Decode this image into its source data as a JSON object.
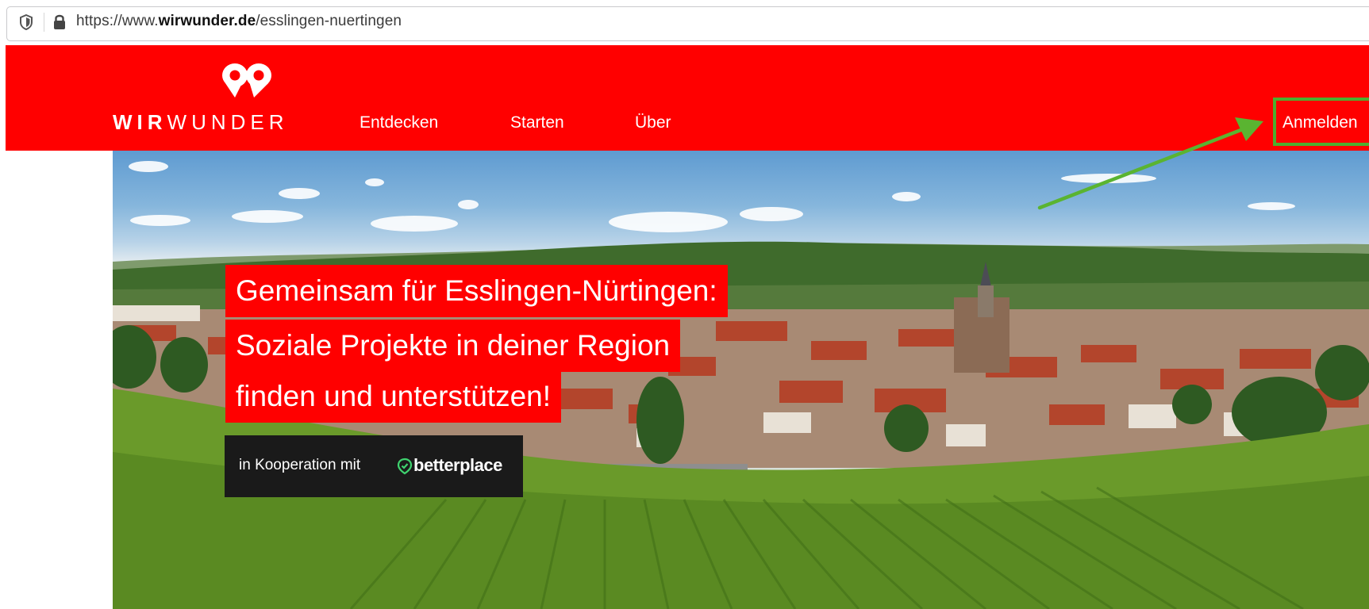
{
  "browser": {
    "url_prefix": "https://www.",
    "url_domain": "wirwunder.de",
    "url_path": "/esslingen-nuertingen"
  },
  "header": {
    "logo_wir": "WIR",
    "logo_wunder": "WUNDER",
    "nav": [
      {
        "label": "Entdecken"
      },
      {
        "label": "Starten"
      },
      {
        "label": "Über"
      }
    ],
    "login_label": "Anmelden"
  },
  "hero": {
    "headline_lines": [
      "Gemeinsam für Esslingen-Nürtingen:",
      "Soziale Projekte in deiner Region",
      "finden und unterstützen!"
    ],
    "cooperation_text": "in Kooperation mit",
    "partner_name": "betterplace"
  },
  "colors": {
    "brand_red": "#ff0000",
    "highlight_green": "#4caf2f",
    "coop_box": "#1a1a1a"
  },
  "icons": [
    "shield-icon",
    "lock-icon",
    "wirwunder-logo-icon",
    "betterplace-icon",
    "annotation-arrow"
  ]
}
